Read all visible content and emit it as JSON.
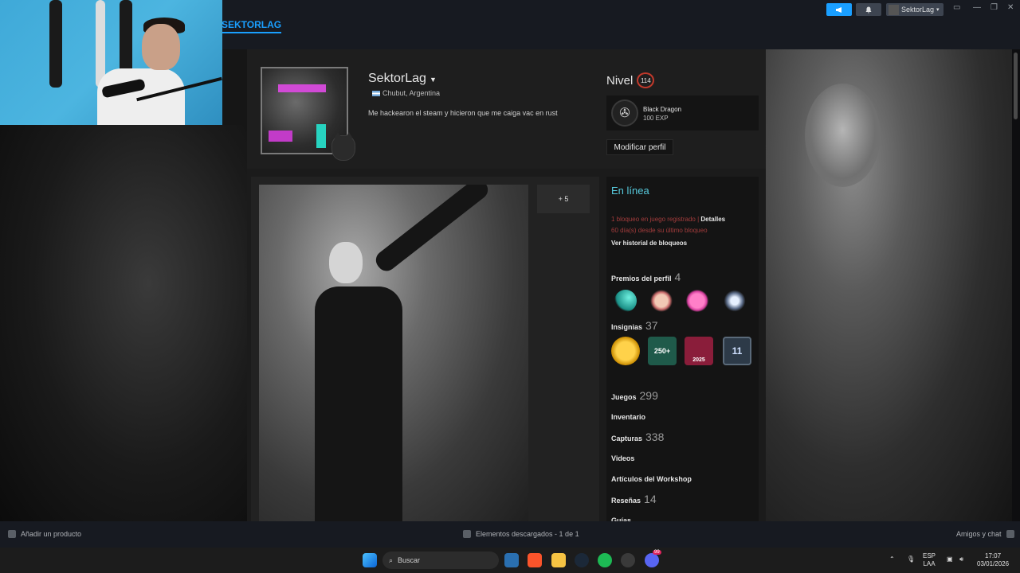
{
  "app": {
    "nav_title": "SEKTORLAG",
    "account_name": "SektorLag"
  },
  "profile": {
    "name": "SektorLag",
    "location": "Chubut, Argentina",
    "summary": "Me hackearon el steam y hicieron que me caiga vac en rust",
    "level_label": "Nivel",
    "level": "114",
    "featured_badge_name": "Black Dragon",
    "featured_badge_xp": "100 EXP",
    "edit_button": "Modificar perfil",
    "showcase_more": "+ 5"
  },
  "sidebar": {
    "status": "En línea",
    "vac_text": "1 bloqueo en juego registrado",
    "vac_separator": "|",
    "vac_details": "Detalles",
    "vac_days": "60 día(s) desde su último bloqueo",
    "vac_history": "Ver historial de bloqueos",
    "awards_label": "Premios del perfil",
    "awards_count": "4",
    "badges_label": "Insignias",
    "badges_count": "37",
    "badge_250": "250+",
    "badge_year": "2025",
    "badge_11": "11",
    "games_label": "Juegos",
    "games_count": "299",
    "inventory_label": "Inventario",
    "screenshots_label": "Capturas",
    "screenshots_count": "338",
    "videos_label": "Videos",
    "workshop_label": "Artículos del Workshop",
    "reviews_label": "Reseñas",
    "reviews_count": "14",
    "guides_label": "Guías"
  },
  "bottombar": {
    "add_product": "Añadir un producto",
    "downloads": "Elementos descargados - 1 de 1",
    "friends": "Amigos y chat"
  },
  "taskbar": {
    "search_placeholder": "Buscar",
    "lang": "ESP",
    "layout": "LAA",
    "time": "17:07",
    "date": "03/01/2026",
    "discord_badge": "99"
  },
  "colors": {
    "accent": "#1a9fff",
    "online": "#57cbde",
    "vac_red": "#a33c3c",
    "level_ring": "#c0392b"
  }
}
